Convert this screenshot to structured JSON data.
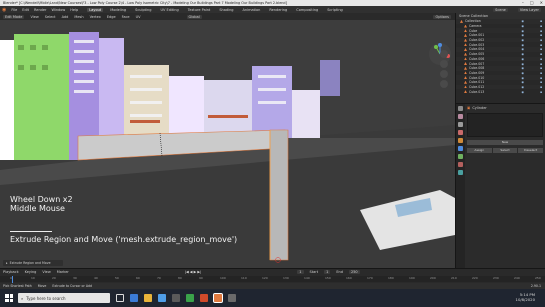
{
  "window": {
    "title": "Blender* [C:\\Wendell\\Mbile\\Land\\New Courses\\F3 - Low Poly Course 2\\4 - Low Poly Isometric City\\7 - Modeling Our Buildings Part 7 Modeling Our Buildings Part 2.blend]",
    "controls": [
      "–",
      "□",
      "✕"
    ]
  },
  "menubar": {
    "menus": [
      "File",
      "Edit",
      "Render",
      "Window",
      "Help"
    ],
    "workspaces": [
      "Layout",
      "Modeling",
      "Sculpting",
      "UV Editing",
      "Texture Paint",
      "Shading",
      "Animation",
      "Rendering",
      "Compositing",
      "Scripting"
    ],
    "active_workspace": "Layout",
    "scene": "Scene",
    "view_layer": "View Layer"
  },
  "viewport_header": {
    "mode": "Edit Mode",
    "menus": [
      "View",
      "Select",
      "Add",
      "Mesh",
      "Vertex",
      "Edge",
      "Face",
      "UV"
    ],
    "transform": "Global",
    "options": "Options"
  },
  "outliner": {
    "title": "Scene Collection",
    "items": [
      {
        "name": "Collection",
        "depth": 0
      },
      {
        "name": "Camera",
        "depth": 1
      },
      {
        "name": "Cube",
        "depth": 1
      },
      {
        "name": "Cube.001",
        "depth": 1
      },
      {
        "name": "Cube.002",
        "depth": 1
      },
      {
        "name": "Cube.003",
        "depth": 1
      },
      {
        "name": "Cube.004",
        "depth": 1
      },
      {
        "name": "Cube.005",
        "depth": 1
      },
      {
        "name": "Cube.006",
        "depth": 1
      },
      {
        "name": "Cube.007",
        "depth": 1
      },
      {
        "name": "Cube.008",
        "depth": 1
      },
      {
        "name": "Cube.009",
        "depth": 1
      },
      {
        "name": "Cube.010",
        "depth": 1
      },
      {
        "name": "Cube.011",
        "depth": 1
      },
      {
        "name": "Cube.012",
        "depth": 1
      },
      {
        "name": "Cube.013",
        "depth": 1
      }
    ]
  },
  "properties": {
    "object_name": "Cylinder",
    "buttons": [
      "New"
    ],
    "actions": [
      "Assign",
      "Select",
      "Deselect"
    ]
  },
  "overlay": {
    "hint_line1": "Wheel Down x2",
    "hint_line2": "Middle Mouse",
    "operator": "Extrude Region and Move ('mesh.extrude_region_move')",
    "last_op_panel": "Extrude Region and Move"
  },
  "timeline": {
    "controls": [
      "Playback",
      "Keying",
      "View",
      "Marker"
    ],
    "current_frame": "1",
    "start_label": "Start",
    "start": "1",
    "end_label": "End",
    "end": "250",
    "ticks": [
      "0",
      "10",
      "20",
      "30",
      "40",
      "50",
      "60",
      "70",
      "80",
      "90",
      "100",
      "110",
      "120",
      "130",
      "140",
      "150",
      "160",
      "170",
      "180",
      "190",
      "200",
      "210",
      "220",
      "230",
      "240",
      "250"
    ]
  },
  "statusbar": {
    "items": [
      "Pick Shortest Path",
      "Move",
      "Extrude to Cursor or Add"
    ],
    "version": "2.90.1"
  },
  "taskbar": {
    "search_placeholder": "Type here to search",
    "time": "5:14 PM",
    "date": "10/8/2020"
  },
  "colors": {
    "accent": "#4e8ce0",
    "viewport_bg": "#3d3d3d",
    "ui_bg": "#2b2b2b",
    "building_green": "#8fd86a",
    "building_purple": "#a58fe0",
    "selection_orange": "#e07a3f"
  }
}
